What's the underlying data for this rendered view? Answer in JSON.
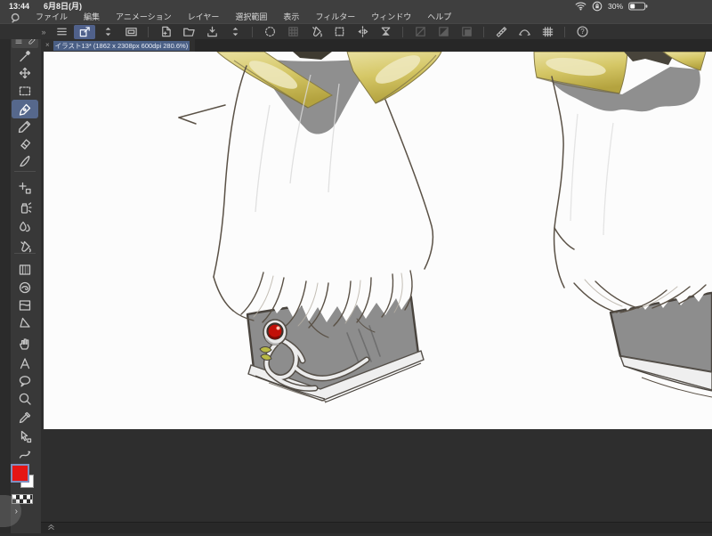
{
  "status_bar": {
    "time": "13:44",
    "date": "6月8日(月)",
    "battery_percent": "30%",
    "icons": [
      "wifi-icon",
      "orientation-lock-icon",
      "battery-icon"
    ]
  },
  "menu_bar": {
    "logo_icon": "clip-studio-logo-icon",
    "items": [
      "ファイル",
      "編集",
      "アニメーション",
      "レイヤー",
      "選択範囲",
      "表示",
      "フィルター",
      "ウィンドウ",
      "ヘルプ"
    ]
  },
  "command_bar": {
    "overflow_glyph": "»",
    "items": [
      {
        "icon": "menu-icon"
      },
      {
        "icon": "pan-canvas-icon",
        "selected": true
      },
      {
        "icon": "updown-chevron-icon"
      },
      {
        "icon": "screen-layout-icon"
      },
      "sep",
      {
        "icon": "new-file-icon"
      },
      {
        "icon": "open-folder-icon"
      },
      {
        "icon": "export-icon"
      },
      {
        "icon": "updown-chevron-icon"
      },
      "sep",
      {
        "icon": "settings-dots-icon"
      },
      {
        "icon": "grid-icon",
        "disabled": true
      },
      {
        "icon": "fill-bucket-icon"
      },
      {
        "icon": "crop-icon"
      },
      {
        "icon": "flip-horizontal-icon"
      },
      {
        "icon": "flip-vertical-icon"
      },
      "sep",
      {
        "icon": "select-new-icon",
        "disabled": true
      },
      {
        "icon": "select-add-icon",
        "disabled": true
      },
      {
        "icon": "select-filled-icon",
        "disabled": true
      },
      "sep",
      {
        "icon": "snap-ruler-icon"
      },
      {
        "icon": "snap-curve-icon"
      },
      {
        "icon": "snap-grid-icon"
      },
      "sep",
      {
        "icon": "help-icon"
      }
    ]
  },
  "tab_bar": {
    "close_glyph": "×",
    "title": "イラスト13* (1862 x 2308px 600dpi 280.6%)"
  },
  "tool_palette": {
    "overflow_glyphs": "« »",
    "header_icons": [
      "menu-icon",
      "pen-small-icon"
    ],
    "selected_tool": "pen",
    "tools": [
      {
        "icon": "wand-icon",
        "label": "auto-select"
      },
      {
        "icon": "move-icon",
        "label": "move"
      },
      {
        "icon": "marquee-icon",
        "label": "marquee"
      },
      {
        "icon": "pen-icon",
        "label": "pen"
      },
      {
        "icon": "pencil-icon",
        "label": "pencil"
      },
      {
        "icon": "eraser-icon",
        "label": "eraser"
      },
      {
        "icon": "brush-icon",
        "label": "brush"
      },
      {
        "icon": "decoration-icon",
        "label": "decoration"
      },
      {
        "icon": "airbrush-icon",
        "label": "airbrush"
      },
      {
        "icon": "blend-icon",
        "label": "blend"
      },
      {
        "icon": "fill-bucket-icon",
        "label": "fill"
      },
      {
        "icon": "gradient-icon",
        "label": "gradient"
      },
      {
        "icon": "color-mix-icon",
        "label": "color-mix"
      },
      {
        "icon": "frame-icon",
        "label": "frame-border"
      },
      {
        "icon": "figure-icon",
        "label": "figure"
      },
      {
        "icon": "hand-icon",
        "label": "hand"
      },
      {
        "icon": "text-icon",
        "label": "text"
      },
      {
        "icon": "balloon-icon",
        "label": "balloon"
      },
      {
        "icon": "zoom-icon",
        "label": "zoom"
      },
      {
        "icon": "eyedropper-icon",
        "label": "eyedropper"
      },
      {
        "icon": "operation-icon",
        "label": "operation"
      },
      {
        "icon": "line-correct-icon",
        "label": "line-correct"
      }
    ],
    "foreground_color": "#e51515",
    "background_color": "#ffffff"
  },
  "bottom_bar": {
    "icon": "collapse-chevrons-icon"
  },
  "edge_handle_glyph": "›",
  "canvas_artwork": {
    "subject": "two fluffy white furred legs with golden ribbon bows at top and armored gray boots, left boot decorated with red gem and silver tendrils",
    "palette": {
      "canvas_white": "#fcfcfc",
      "sketch_line": "#5a5146",
      "fur_shadow_gray": "#8f8f8f",
      "gold_ribbon": "#d5c766",
      "gold_highlight": "#efe9c0",
      "boot_gray": "#8d8d8d",
      "boot_outline": "#49443e",
      "silver_trim": "#ececec",
      "gem_red": "#c21008",
      "leaf_yellow": "#b9b944"
    }
  },
  "ui_colors": {
    "selection_accent": "#50618b",
    "tab_highlight": "#4a5f85",
    "bar_dark": "#3f3f3f",
    "pasteboard": "#2e2e2e"
  }
}
